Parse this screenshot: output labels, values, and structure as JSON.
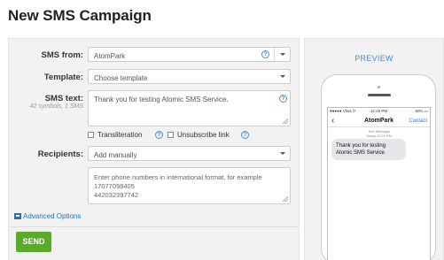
{
  "page": {
    "title": "New SMS Campaign"
  },
  "form": {
    "sms_from": {
      "label": "SMS from:",
      "value": "AtomPark"
    },
    "template": {
      "label": "Template:",
      "value": "Choose template"
    },
    "sms_text": {
      "label": "SMS text:",
      "counter": "42 symbols, 1 SMS",
      "value": "Thank you for testing Atomic SMS Service."
    },
    "options": {
      "transliteration_label": "Transliteration",
      "unsubscribe_label": "Unsubscribe link"
    },
    "recipients": {
      "label": "Recipients:",
      "value": "Add manually",
      "numbers_placeholder": "Enter phone numbers in international format, for example\n17077098405\n442032397742"
    },
    "advanced_options_label": "Advanced Options",
    "send_label": "SEND"
  },
  "preview": {
    "title": "PREVIEW",
    "status_carrier": "●●●●● Vfw1 ᐅ",
    "status_time": "12:25 PM",
    "status_battery": "50% ▭",
    "back_glyph": "‹",
    "sender_name": "AtomPark",
    "contact_label": "Contact",
    "meta_line1": "Text Message",
    "meta_line2": "Today 12:25 PM",
    "message": "Thank you for testing Atomic SMS Service."
  },
  "icons": {
    "help": "question-circle-icon",
    "dropdown": "chevron-down-icon",
    "advanced": "window-icon"
  },
  "colors": {
    "accent_blue": "#2a6fb3",
    "send_green": "#5aab2c",
    "panel_bg": "#f2f2f2",
    "ios_blue": "#1a7cf5"
  }
}
